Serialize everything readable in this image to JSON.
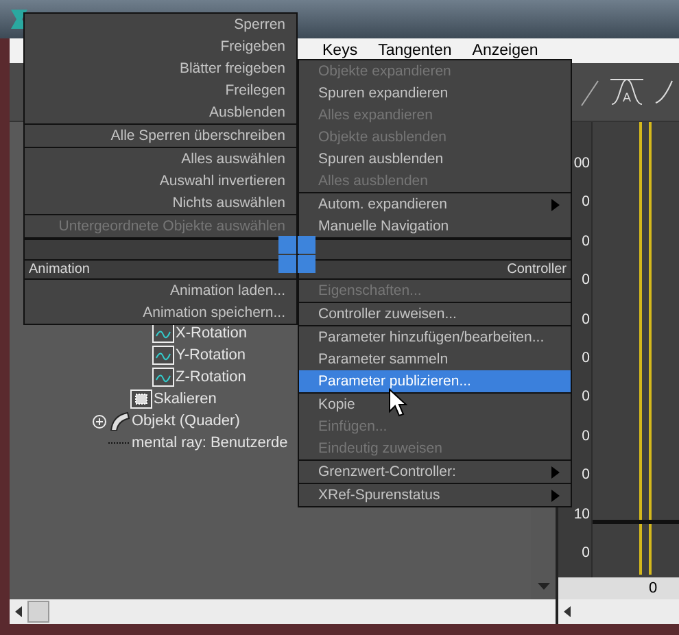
{
  "menu_bar": [
    "Keys",
    "Tangenten",
    "Anzeigen"
  ],
  "tree": [
    {
      "children": [
        {
          "children": [
            {
              "label": "X-Rotation",
              "kind": "curve"
            },
            {
              "label": "Y-Rotation",
              "kind": "curve"
            },
            {
              "label": "Z-Rotation",
              "kind": "curve"
            }
          ]
        },
        {
          "label": "Skalieren",
          "kind": "scale"
        }
      ]
    },
    {
      "label": "Objekt (Quader)",
      "kind": "object",
      "expanded": false
    },
    {
      "label": "mental ray: Benutzerde",
      "kind": "plain"
    }
  ],
  "toolbar": {
    "tangent_tool_label": "A"
  },
  "graph": {
    "axis_labels": [
      "00",
      "0",
      "0",
      "0",
      "0",
      "0",
      "0",
      "0",
      "0",
      "10",
      "0"
    ],
    "time_label": "0"
  },
  "left_quad": {
    "header": "Animation",
    "sections_above": [
      [
        {
          "label": "Sperren",
          "disabled": false,
          "selected": false,
          "submenu": false
        },
        {
          "label": "Freigeben",
          "disabled": false,
          "selected": false,
          "submenu": false
        },
        {
          "label": "Blätter freigeben",
          "disabled": false,
          "selected": false,
          "submenu": false
        },
        {
          "label": "Freilegen",
          "disabled": false,
          "selected": false,
          "submenu": false
        },
        {
          "label": "Ausblenden",
          "disabled": false,
          "selected": false,
          "submenu": false
        }
      ],
      [
        {
          "label": "Alle Sperren überschreiben",
          "disabled": false,
          "selected": false,
          "submenu": false
        }
      ],
      [
        {
          "label": "Alles auswählen",
          "disabled": false,
          "selected": false,
          "submenu": false
        },
        {
          "label": "Auswahl invertieren",
          "disabled": false,
          "selected": false,
          "submenu": false
        },
        {
          "label": "Nichts auswählen",
          "disabled": false,
          "selected": false,
          "submenu": false
        }
      ],
      [
        {
          "label": "Untergeordnete Objekte auswählen",
          "disabled": true,
          "selected": false,
          "submenu": false
        }
      ]
    ],
    "sections_below": [
      [
        {
          "label": "Animation laden...",
          "disabled": false,
          "selected": false,
          "submenu": false
        },
        {
          "label": "Animation speichern...",
          "disabled": false,
          "selected": false,
          "submenu": false
        }
      ]
    ]
  },
  "right_quad": {
    "header": "Controller",
    "sections_above": [
      [
        {
          "label": "Objekte expandieren",
          "disabled": true,
          "selected": false,
          "submenu": false
        },
        {
          "label": "Spuren expandieren",
          "disabled": false,
          "selected": false,
          "submenu": false
        },
        {
          "label": "Alles expandieren",
          "disabled": true,
          "selected": false,
          "submenu": false
        },
        {
          "label": "Objekte ausblenden",
          "disabled": true,
          "selected": false,
          "submenu": false
        },
        {
          "label": "Spuren ausblenden",
          "disabled": false,
          "selected": false,
          "submenu": false
        },
        {
          "label": "Alles ausblenden",
          "disabled": true,
          "selected": false,
          "submenu": false
        }
      ],
      [
        {
          "label": "Autom. expandieren",
          "disabled": false,
          "selected": false,
          "submenu": true
        },
        {
          "label": "Manuelle Navigation",
          "disabled": false,
          "selected": false,
          "submenu": false
        }
      ]
    ],
    "sections_below": [
      [
        {
          "label": "Eigenschaften...",
          "disabled": true,
          "selected": false,
          "submenu": false
        }
      ],
      [
        {
          "label": "Controller zuweisen...",
          "disabled": false,
          "selected": false,
          "submenu": false
        }
      ],
      [
        {
          "label": "Parameter hinzufügen/bearbeiten...",
          "disabled": false,
          "selected": false,
          "submenu": false
        },
        {
          "label": "Parameter sammeln",
          "disabled": false,
          "selected": false,
          "submenu": false
        },
        {
          "label": "Parameter publizieren...",
          "disabled": false,
          "selected": true,
          "submenu": false
        }
      ],
      [
        {
          "label": "Kopie",
          "disabled": false,
          "selected": false,
          "submenu": false
        },
        {
          "label": "Einfügen...",
          "disabled": true,
          "selected": false,
          "submenu": false
        },
        {
          "label": "Eindeutig zuweisen",
          "disabled": true,
          "selected": false,
          "submenu": false
        }
      ],
      [
        {
          "label": "Grenzwert-Controller:",
          "disabled": false,
          "selected": false,
          "submenu": true
        }
      ],
      [
        {
          "label": "XRef-Spurenstatus",
          "disabled": false,
          "selected": false,
          "submenu": true
        }
      ]
    ]
  }
}
